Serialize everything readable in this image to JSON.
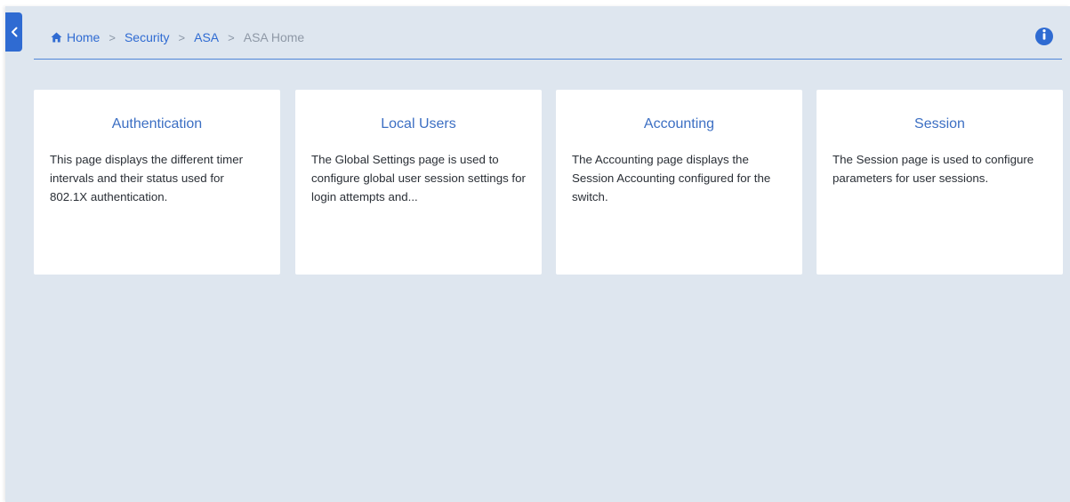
{
  "sidebar": {
    "collapse_icon": "chevron-left-icon"
  },
  "breadcrumb": {
    "home_icon": "home-icon",
    "items": [
      {
        "label": "Home"
      },
      {
        "label": "Security"
      },
      {
        "label": "ASA"
      },
      {
        "label": "ASA Home"
      }
    ],
    "separator": ">"
  },
  "header": {
    "info_icon": "info-icon"
  },
  "cards": [
    {
      "title": "Authentication",
      "description": "This page displays the different timer intervals and their status used for 802.1X authentication."
    },
    {
      "title": "Local Users",
      "description": "The Global Settings page is used to configure global user session settings for login attempts and..."
    },
    {
      "title": "Accounting",
      "description": "The Accounting page displays the Session Accounting configured for the switch."
    },
    {
      "title": "Session",
      "description": "The Session page is used to configure parameters for user sessions."
    }
  ],
  "colors": {
    "accent": "#2f6bd2",
    "background": "#dee6ef",
    "card": "#ffffff",
    "card_title": "#3c6fc3",
    "text": "#2a2f36",
    "muted": "#8e98a6"
  }
}
